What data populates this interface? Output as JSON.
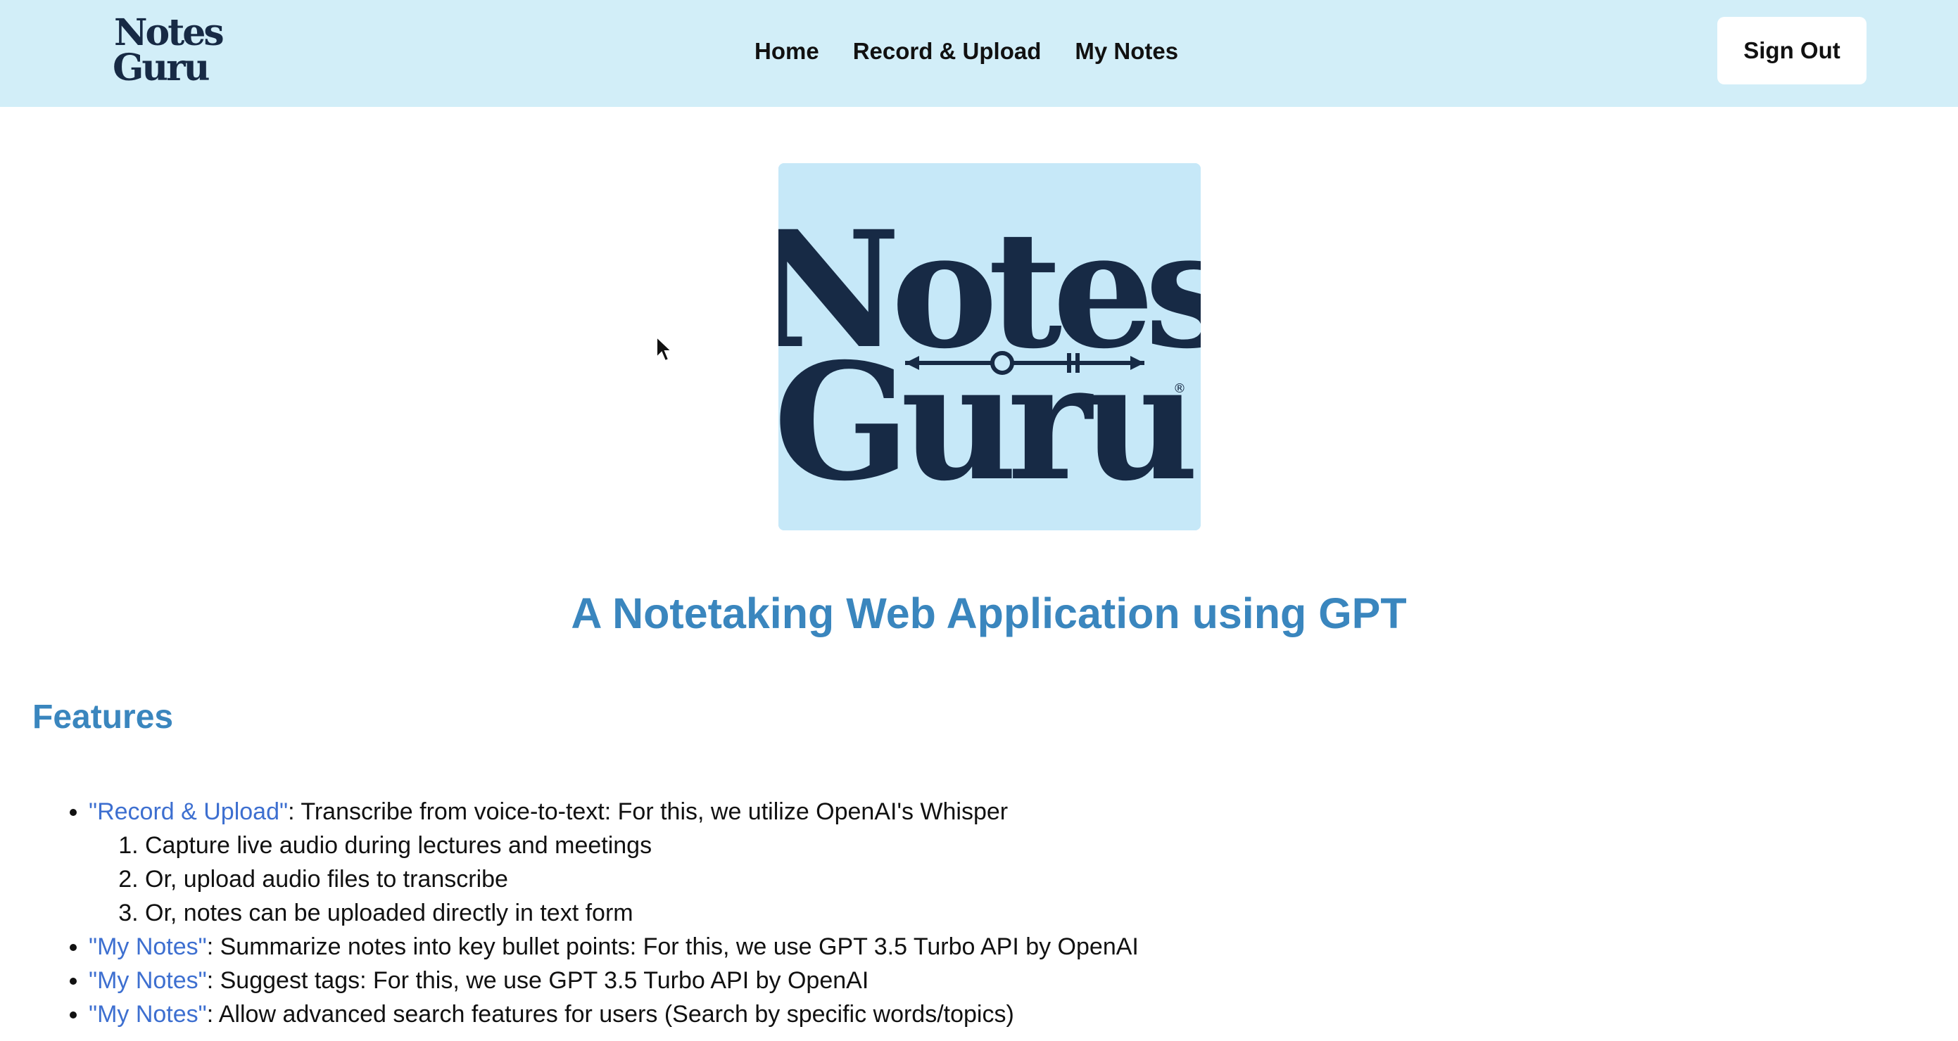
{
  "nav": {
    "logo_line1": "Notes",
    "logo_line2": "Guru",
    "logo_mark": "®",
    "links": [
      "Home",
      "Record & Upload",
      "My Notes"
    ],
    "signout_label": "Sign Out"
  },
  "hero": {
    "logo_line1": "Notes",
    "logo_line2": "Guru",
    "logo_mark": "®"
  },
  "subtitle": "A Notetaking Web Application using GPT",
  "features": {
    "heading": "Features",
    "items": [
      {
        "link": "\"Record & Upload\"",
        "text": ": Transcribe from voice-to-text: For this, we utilize OpenAI's Whisper",
        "subitems": [
          "Capture live audio during lectures and meetings",
          "Or, upload audio files to transcribe",
          "Or, notes can be uploaded directly in text form"
        ]
      },
      {
        "link": "\"My Notes\"",
        "text": ": Summarize notes into key bullet points: For this, we use GPT 3.5 Turbo API by OpenAI"
      },
      {
        "link": "\"My Notes\"",
        "text": ": Suggest tags: For this, we use GPT 3.5 Turbo API by OpenAI"
      },
      {
        "link": "\"My Notes\"",
        "text": ": Allow advanced search features for users (Search by specific words/topics)"
      }
    ]
  },
  "colors": {
    "navbar_bg": "#d2eef8",
    "accent_blue": "#3a86be",
    "link_blue": "#3d6fd0",
    "logo_navy": "#172a45",
    "logo_bg": "#c6e8f8"
  }
}
